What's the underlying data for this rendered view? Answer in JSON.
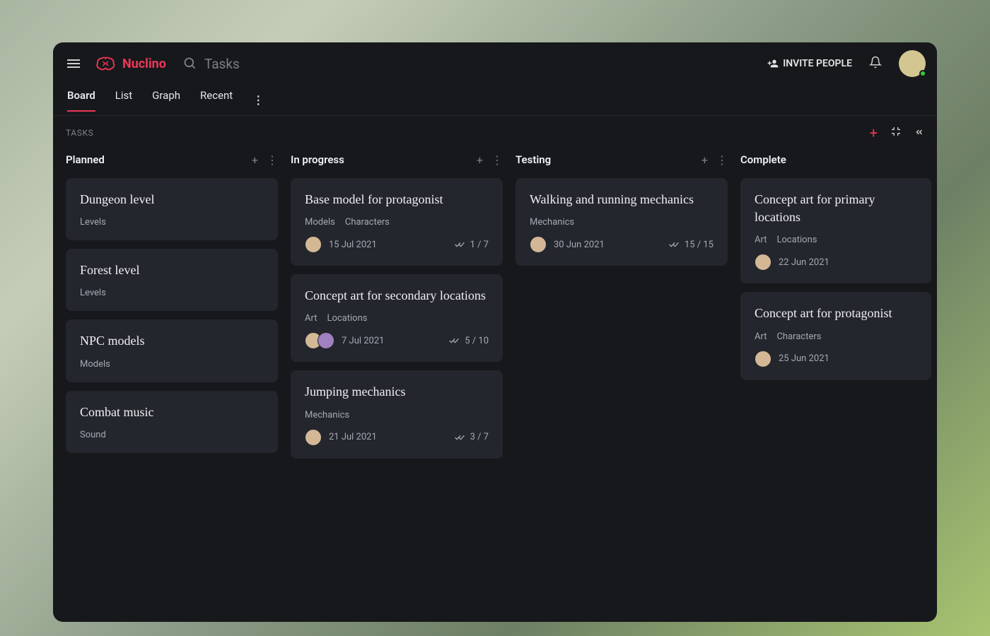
{
  "brand": {
    "name": "Nuclino"
  },
  "search": {
    "placeholder": "Tasks"
  },
  "topbar": {
    "invite_label": "INVITE PEOPLE"
  },
  "tabs": {
    "board": "Board",
    "list": "List",
    "graph": "Graph",
    "recent": "Recent"
  },
  "subheader": {
    "title": "TASKS"
  },
  "columns": [
    {
      "title": "Planned",
      "cards": [
        {
          "title": "Dungeon level",
          "tags": [
            "Levels"
          ]
        },
        {
          "title": "Forest level",
          "tags": [
            "Levels"
          ]
        },
        {
          "title": "NPC models",
          "tags": [
            "Models"
          ]
        },
        {
          "title": "Combat music",
          "tags": [
            "Sound"
          ]
        }
      ]
    },
    {
      "title": "In progress",
      "cards": [
        {
          "title": "Base model for protagonist",
          "tags": [
            "Models",
            "Characters"
          ],
          "avatars": 1,
          "date": "15 Jul 2021",
          "progress": "1 / 7"
        },
        {
          "title": "Concept art for secondary locations",
          "tags": [
            "Art",
            "Locations"
          ],
          "avatars": 2,
          "date": "7 Jul 2021",
          "progress": "5 / 10"
        },
        {
          "title": "Jumping mechanics",
          "tags": [
            "Mechanics"
          ],
          "avatars": 1,
          "date": "21 Jul 2021",
          "progress": "3 / 7"
        }
      ]
    },
    {
      "title": "Testing",
      "cards": [
        {
          "title": "Walking and running mechanics",
          "tags": [
            "Mechanics"
          ],
          "avatars": 1,
          "date": "30 Jun 2021",
          "progress": "15 / 15"
        }
      ]
    },
    {
      "title": "Complete",
      "cards": [
        {
          "title": "Concept art for primary locations",
          "tags": [
            "Art",
            "Locations"
          ],
          "avatars": 1,
          "date": "22 Jun 2021"
        },
        {
          "title": "Concept art for protagonist",
          "tags": [
            "Art",
            "Characters"
          ],
          "avatars": 1,
          "date": "25 Jun 2021"
        }
      ]
    }
  ]
}
